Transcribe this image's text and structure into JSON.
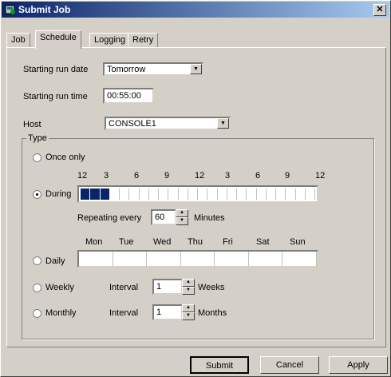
{
  "window": {
    "title": "Submit Job",
    "close_glyph": "✕"
  },
  "tabs": [
    "Job",
    "Schedule",
    "Logging",
    "Retry"
  ],
  "active_tab": "Schedule",
  "starting_run_date": {
    "label": "Starting run date",
    "value": "Tomorrow"
  },
  "starting_run_time": {
    "label": "Starting run time",
    "value": "00:55:00"
  },
  "host": {
    "label": "Host",
    "value": "CONSOLE1"
  },
  "type_group": {
    "label": "Type",
    "selected": "During",
    "once_only": "Once only",
    "during": "During",
    "hour_ticks": [
      "12",
      "3",
      "6",
      "9",
      "12",
      "3",
      "6",
      "9",
      "12"
    ],
    "hour_slots": 24,
    "selected_hours": [
      0,
      1,
      2
    ],
    "repeating_label": "Repeating every",
    "repeating_value": "60",
    "repeating_unit": "Minutes",
    "daily": "Daily",
    "days": [
      "Mon",
      "Tue",
      "Wed",
      "Thu",
      "Fri",
      "Sat",
      "Sun"
    ],
    "weekly": "Weekly",
    "weekly_interval_label": "Interval",
    "weekly_interval_value": "1",
    "weekly_unit": "Weeks",
    "monthly": "Monthly",
    "monthly_interval_label": "Interval",
    "monthly_interval_value": "1",
    "monthly_unit": "Months"
  },
  "buttons": {
    "submit": "Submit",
    "cancel": "Cancel",
    "apply": "Apply"
  },
  "colors": {
    "title_start": "#0a246a",
    "title_end": "#a6caf0",
    "selection": "#0a246a",
    "face": "#d4d0c8"
  }
}
